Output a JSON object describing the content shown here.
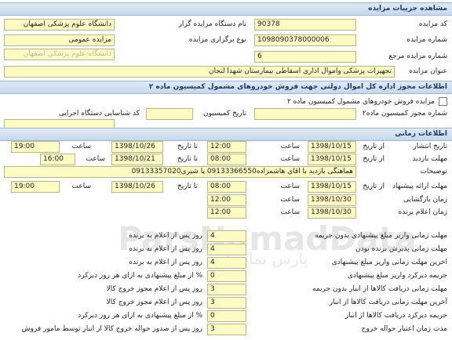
{
  "section_main": {
    "title": "مشاهده جزییات مزایده"
  },
  "main": {
    "auction_code_label": "کد مزایده",
    "auction_code": "90378",
    "organizer_name_label": "نام دستگاه مزایده گزار",
    "organizer_name": "دانشگاه علوم پزشکی اصفهان",
    "auction_number_label": "شماره مزایده",
    "auction_number": "1098090378000006",
    "holding_type_label": "نوع برگزاری مزایده",
    "holding_type": "مزایده عمومی",
    "org_faded": "دانشگاه علوم پزشکی اصفهان",
    "reference_number_label": "شماره مزایده مرجع",
    "reference_number": "6",
    "auction_title_label": "عنوان مزایده",
    "auction_title": "تجهیزات پزشکی واموال اداری اسقاطی بیمارستان شهدا لنجان"
  },
  "section_license": {
    "title": "اطلاعات مجوز اداره کل اموال دولتی جهت فروش خودروهای مشمول کمیسیون ماده ۲"
  },
  "license": {
    "checkbox_label": "مزایده فروش خودروهای مشمول کمیسیون ماده ۲",
    "license_number_label": "شماره مجوز کمیسیون ماده۲",
    "commission_date_label": "تاریخ کمیسیون",
    "device_id_label": "کد شناسایی دستگاه اجرایی"
  },
  "section_time": {
    "title": "اطلاعات زمانی"
  },
  "time": {
    "publish_label": "تاریخ انتشار",
    "from_date_label": "از تاریخ",
    "to_date_label": "تا تاریخ",
    "time_label": "ساعت",
    "publish_from_date": "1398/10/15",
    "publish_from_time": "12:00",
    "publish_to_date": "1398/10/26",
    "publish_to_time": "19:00",
    "visit_label": "مهلت بازدید",
    "visit_from_date": "1398/10/15",
    "visit_from_time": "08:00",
    "visit_to_date": "1398/10/21",
    "visit_to_time": "16:00",
    "notes_label": "توضیحات",
    "notes": "هماهنگی بازدید با اقای هاشمزاده09133366550 یا شیری09133357020",
    "offer_label": "مهلت ارائه پیشنهاد",
    "offer_from_date": "1398/10/15",
    "offer_from_time": "08:00",
    "offer_to_date": "1398/10/26",
    "offer_to_time": "19:00",
    "opening_label": "زمان بازگشایی",
    "opening_date": "1398/10/30",
    "opening_time": "12:00",
    "winner_label": "زمان اعلام برنده",
    "winner_date": "1398/10/30",
    "winner_time": "12:00"
  },
  "deadlines": [
    {
      "label": "مهلت زمانی واریز مبلغ پیشنهادی بدون جریمه",
      "value": "4",
      "suffix": "روز پس از اعلام به برنده"
    },
    {
      "label": "مهلت زمانی پذیرش برنده بودن",
      "value": "4",
      "suffix": "روز پس از اعلام به برنده"
    },
    {
      "label": "اخرین مهلت زمانی واریز مبلغ پیشنهادی",
      "value": "4",
      "suffix": "روز پس از اعلام به برنده"
    },
    {
      "label": "جریمه دیرکرد واریز مبلغ پیشنهادی",
      "value": "0",
      "suffix": "% از مبلغ پیشنهادی به ازای هر روز دیرکرد"
    },
    {
      "label": "مهلت زمانی دریافت کالاها از انبار بدون جریمه",
      "value": "3",
      "suffix": "روز پس از اعلام مجوز خروج کالا"
    },
    {
      "label": "آخرین مهلت زمانی دریافت کالاها از انبار",
      "value": "3",
      "suffix": "روز پس از اعلام مجوز خروج کالا"
    },
    {
      "label": "جریمه دیرکرد دریافت کالاها از انبار",
      "value": "0",
      "suffix": "% از مبلغ پیشنهادی به ازای هر روز دیرکرد"
    },
    {
      "label": "مدت زمان اعتبار حواله خروج",
      "value": "3",
      "suffix": "روز پس از صدور حواله خروج کالا از انبار توسط مامور فروش"
    }
  ],
  "watermark": {
    "line1": "ParsNamadData",
    "line2": "پارس نماد داده"
  }
}
